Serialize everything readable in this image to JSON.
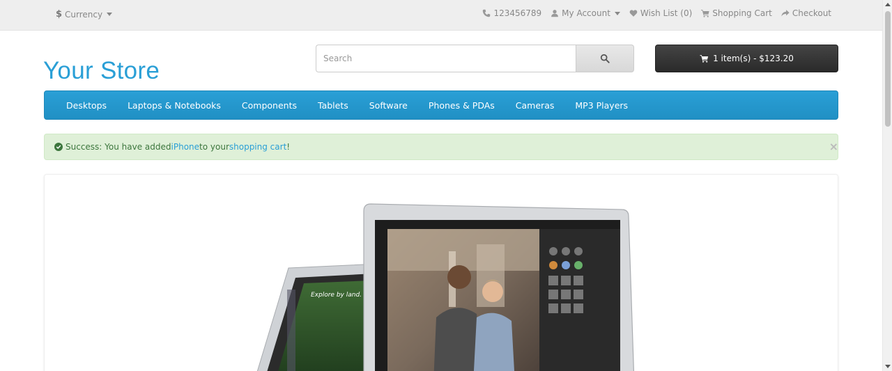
{
  "topbar": {
    "currency_symbol": "$",
    "currency_label": "Currency",
    "phone": "123456789",
    "my_account": "My Account",
    "wishlist": "Wish List (0)",
    "shopping_cart": "Shopping Cart",
    "checkout": "Checkout"
  },
  "header": {
    "logo": "Your Store",
    "search_placeholder": "Search",
    "cart_label": "1 item(s) - $123.20"
  },
  "menu": {
    "items": [
      "Desktops",
      "Laptops & Notebooks",
      "Components",
      "Tablets",
      "Software",
      "Phones & PDAs",
      "Cameras",
      "MP3 Players"
    ]
  },
  "alert": {
    "prefix": "Success: You have added ",
    "product": "iPhone",
    "middle": " to your ",
    "cart_link": "shopping cart",
    "suffix": "!",
    "close": "×"
  },
  "banner": {
    "small_screen_caption": "Explore by land."
  },
  "colors": {
    "brand": "#2a9fd6",
    "success_bg": "#dff0d8",
    "success_text": "#3c763d"
  }
}
